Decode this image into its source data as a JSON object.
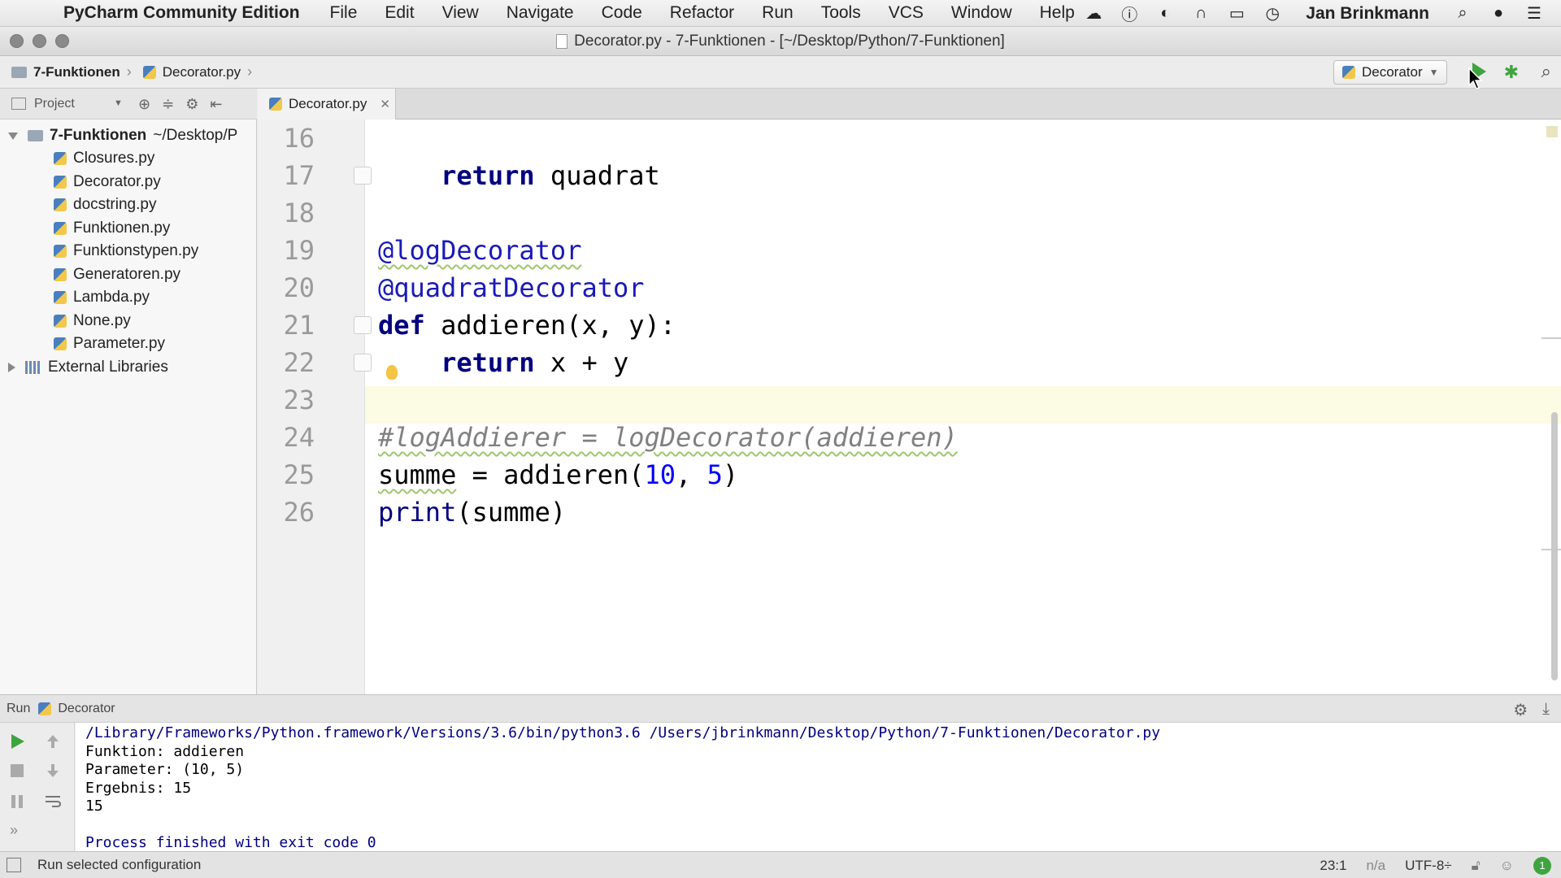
{
  "menubar": {
    "app_name": "PyCharm Community Edition",
    "items": [
      "File",
      "Edit",
      "View",
      "Navigate",
      "Code",
      "Refactor",
      "Run",
      "Tools",
      "VCS",
      "Window",
      "Help"
    ],
    "user": "Jan Brinkmann"
  },
  "window": {
    "title": "Decorator.py - 7-Funktionen - [~/Desktop/Python/7-Funktionen]"
  },
  "navbar": {
    "crumb_folder": "7-Funktionen",
    "crumb_file": "Decorator.py",
    "run_config": "Decorator"
  },
  "project": {
    "header_label": "Project",
    "root_name": "7-Funktionen",
    "root_path": "~/Desktop/P",
    "files": [
      "Closures.py",
      "Decorator.py",
      "docstring.py",
      "Funktionen.py",
      "Funktionstypen.py",
      "Generatoren.py",
      "Lambda.py",
      "None.py",
      "Parameter.py"
    ],
    "external": "External Libraries"
  },
  "editor": {
    "tab_label": "Decorator.py",
    "line_numbers": [
      "16",
      "17",
      "18",
      "19",
      "20",
      "21",
      "22",
      "23",
      "24",
      "25",
      "26"
    ],
    "code": {
      "l17_kw": "return",
      "l17_rest": " quadrat",
      "l19": "@logDecorator",
      "l20": "@quadratDecorator",
      "l21_kw": "def",
      "l21_name": " addieren",
      "l21_rest": "(x, y):",
      "l22_kw": "return",
      "l22_rest": " x + y",
      "l24": "#logAddierer = logDecorator(addieren)",
      "l25_var": "summe",
      "l25_mid": " = addieren(",
      "l25_n1": "10",
      "l25_sep": ", ",
      "l25_n2": "5",
      "l25_end": ")",
      "l26_fn": "print",
      "l26_rest": "(summe)"
    },
    "current_line": "23"
  },
  "run": {
    "header_run": "Run",
    "header_name": "Decorator",
    "console": {
      "path": "/Library/Frameworks/Python.framework/Versions/3.6/bin/python3.6 /Users/jbrinkmann/Desktop/Python/7-Funktionen/Decorator.py",
      "out1": "Funktion: addieren",
      "out2": "Parameter: (10, 5)",
      "out3": "Ergebnis: 15",
      "out4": "15",
      "exit": "Process finished with exit code 0"
    }
  },
  "statusbar": {
    "message": "Run selected configuration",
    "position": "23:1",
    "na": "n/a",
    "encoding": "UTF-8÷",
    "badge": "1"
  },
  "colors": {
    "run_green": "#3fa43f",
    "keyword": "#000080",
    "decorator": "#1a1ab8",
    "number": "#0000ff",
    "comment": "#808080",
    "current_line": "#fcfbe3"
  }
}
